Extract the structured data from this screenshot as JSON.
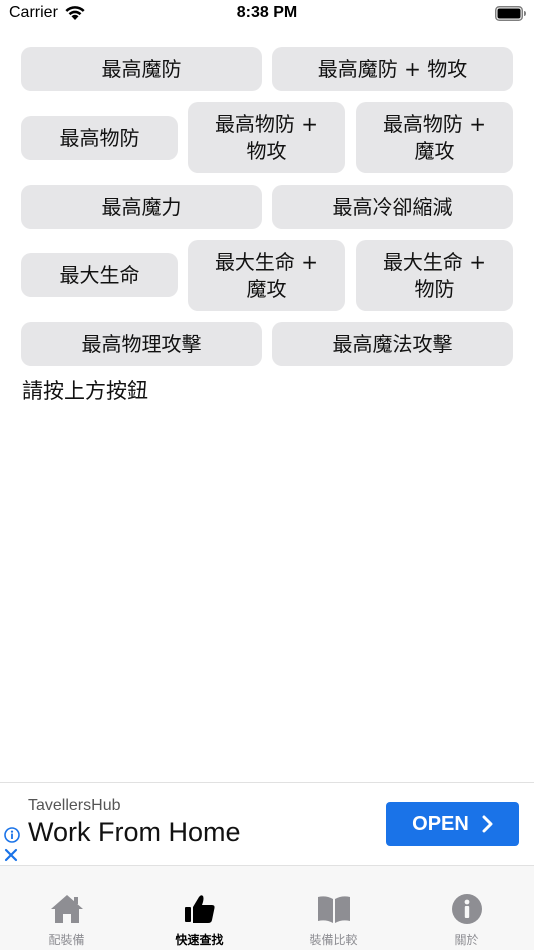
{
  "status_bar": {
    "carrier": "Carrier",
    "time": "8:38 PM"
  },
  "buttons": [
    "最高魔防",
    "最高魔防 + 物攻",
    "最高物防",
    "最高物防 +\n物攻",
    "最高物防 +\n魔攻",
    "最高魔力",
    "最高冷卻縮減",
    "最大生命",
    "最大生命 +\n魔攻",
    "最大生命 +\n物防",
    "最高物理攻擊",
    "最高魔法攻擊"
  ],
  "hint": "請按上方按鈕",
  "ad": {
    "source": "TavellersHub",
    "headline": "Work From Home",
    "cta": "OPEN",
    "cta_color": "#1a73e8"
  },
  "tabs": [
    {
      "label": "配裝備",
      "icon": "house-icon",
      "active": false
    },
    {
      "label": "快速查找",
      "icon": "thumbs-up-icon",
      "active": true
    },
    {
      "label": "裝備比較",
      "icon": "book-icon",
      "active": false
    },
    {
      "label": "關於",
      "icon": "info-icon",
      "active": false
    }
  ]
}
